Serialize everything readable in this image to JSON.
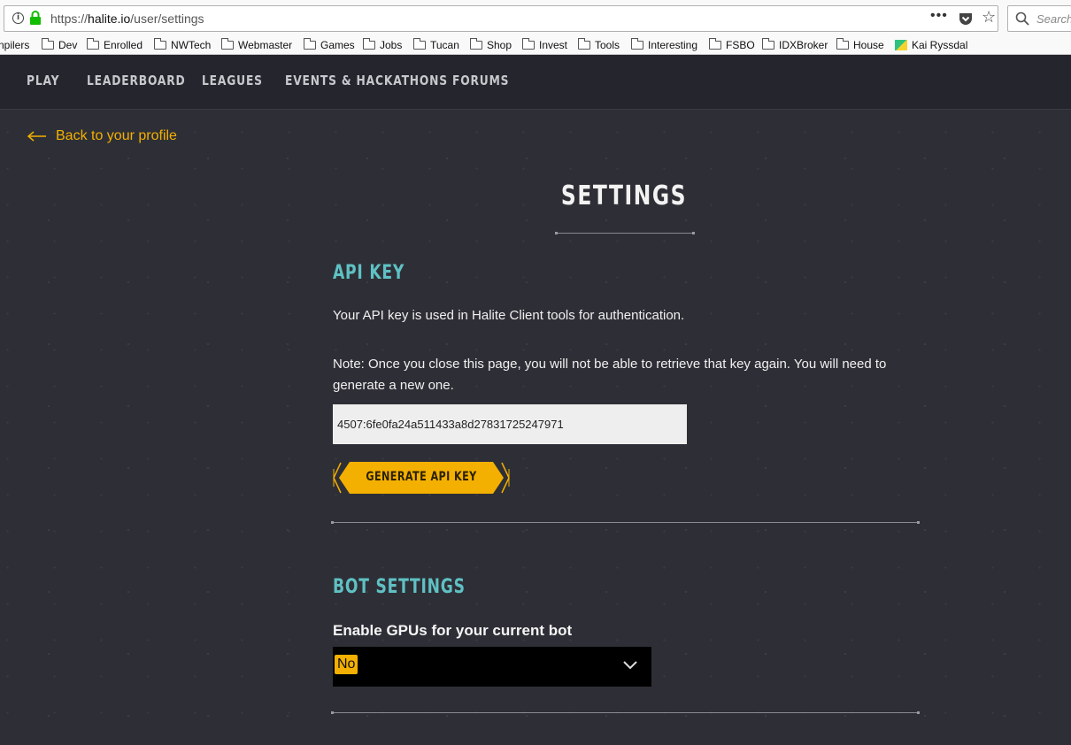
{
  "browser": {
    "url_prefix": "https://",
    "url_host": "halite.io",
    "url_path": "/user/settings",
    "more_label": "•••",
    "search_placeholder": "Search",
    "bookmarks": [
      "npilers",
      "Dev",
      "Enrolled",
      "NWTech",
      "Webmaster",
      "Games",
      "Jobs",
      "Tucan",
      "Shop",
      "Invest",
      "Tools",
      "Interesting",
      "FSBO",
      "IDXBroker",
      "House",
      "Kai Ryssdal"
    ]
  },
  "nav": {
    "items": [
      "PLAY",
      "LEADERBOARD",
      "LEAGUES",
      "EVENTS & HACKATHONS",
      "FORUMS"
    ]
  },
  "back_link": "Back to your profile",
  "page_title": "SETTINGS",
  "api": {
    "heading": "API KEY",
    "description": "Your API key is used in Halite Client tools for authentication.",
    "note": "Note: Once you close this page, you will not be able to retrieve that key again. You will need to generate a new one.",
    "key_value": "4507:6fe0fa24a511433a8d27831725247971",
    "button_label": "GENERATE API KEY"
  },
  "bot": {
    "heading": "BOT SETTINGS",
    "gpu_label": "Enable GPUs for your current bot",
    "gpu_value": "No"
  },
  "colors": {
    "accent": "#f4b000",
    "heading": "#5fc1c4",
    "nav_bg": "#24252d"
  }
}
